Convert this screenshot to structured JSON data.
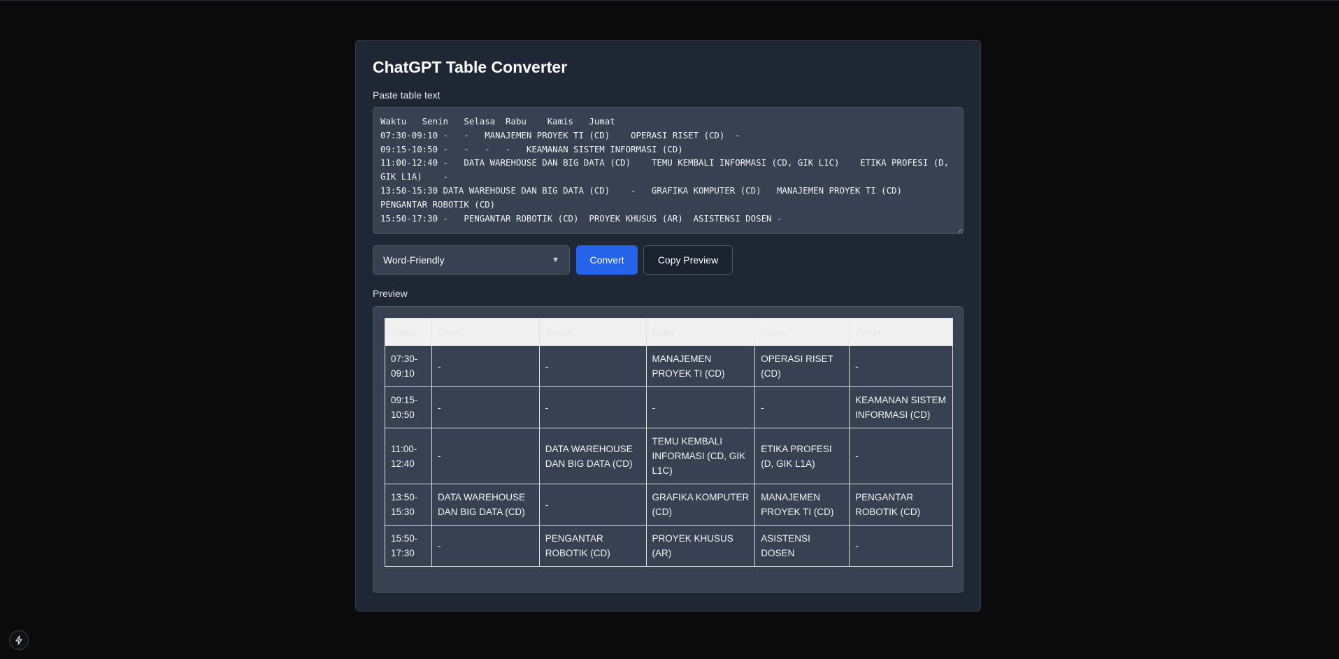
{
  "app": {
    "title": "ChatGPT Table Converter",
    "input_label": "Paste table text",
    "input_value": "Waktu   Senin   Selasa  Rabu    Kamis   Jumat\n07:30-09:10 -   -   MANAJEMEN PROYEK TI (CD)    OPERASI RISET (CD)  -\n09:15-10:50 -   -   -   -   KEAMANAN SISTEM INFORMASI (CD)\n11:00-12:40 -   DATA WAREHOUSE DAN BIG DATA (CD)    TEMU KEMBALI INFORMASI (CD, GIK L1C)    ETIKA PROFESI (D, GIK L1A)    -\n13:50-15:30 DATA WAREHOUSE DAN BIG DATA (CD)    -   GRAFIKA KOMPUTER (CD)   MANAJEMEN PROYEK TI (CD)    PENGANTAR ROBOTIK (CD)\n15:50-17:30 -   PENGANTAR ROBOTIK (CD)  PROYEK KHUSUS (AR)  ASISTENSI DOSEN -",
    "format_selected": "Word-Friendly",
    "convert_label": "Convert",
    "copy_label": "Copy Preview",
    "preview_label": "Preview"
  },
  "table": {
    "headers": [
      "Waktu",
      "Senin",
      "Selasa",
      "Rabu",
      "Kamis",
      "Jumat"
    ],
    "rows": [
      [
        "07:30-09:10",
        "-",
        "-",
        "MANAJEMEN PROYEK TI (CD)",
        "OPERASI RISET (CD)",
        "-"
      ],
      [
        "09:15-10:50",
        "-",
        "-",
        "-",
        "-",
        "KEAMANAN SISTEM INFORMASI (CD)"
      ],
      [
        "11:00-12:40",
        "-",
        "DATA WAREHOUSE DAN BIG DATA (CD)",
        "TEMU KEMBALI INFORMASI (CD, GIK L1C)",
        "ETIKA PROFESI (D, GIK L1A)",
        "-"
      ],
      [
        "13:50-15:30",
        "DATA WAREHOUSE DAN BIG DATA (CD)",
        "-",
        "GRAFIKA KOMPUTER (CD)",
        "MANAJEMEN PROYEK TI (CD)",
        "PENGANTAR ROBOTIK (CD)"
      ],
      [
        "15:50-17:30",
        "-",
        "PENGANTAR ROBOTIK (CD)",
        "PROYEK KHUSUS (AR)",
        "ASISTENSI DOSEN",
        "-"
      ]
    ]
  },
  "icons": {
    "corner": "lightning-bolt-icon",
    "select_arrow": "chevron-down-icon"
  },
  "colors": {
    "page_bg": "#0b0b0c",
    "card_bg": "#1f2734",
    "accent": "#2563eb"
  }
}
